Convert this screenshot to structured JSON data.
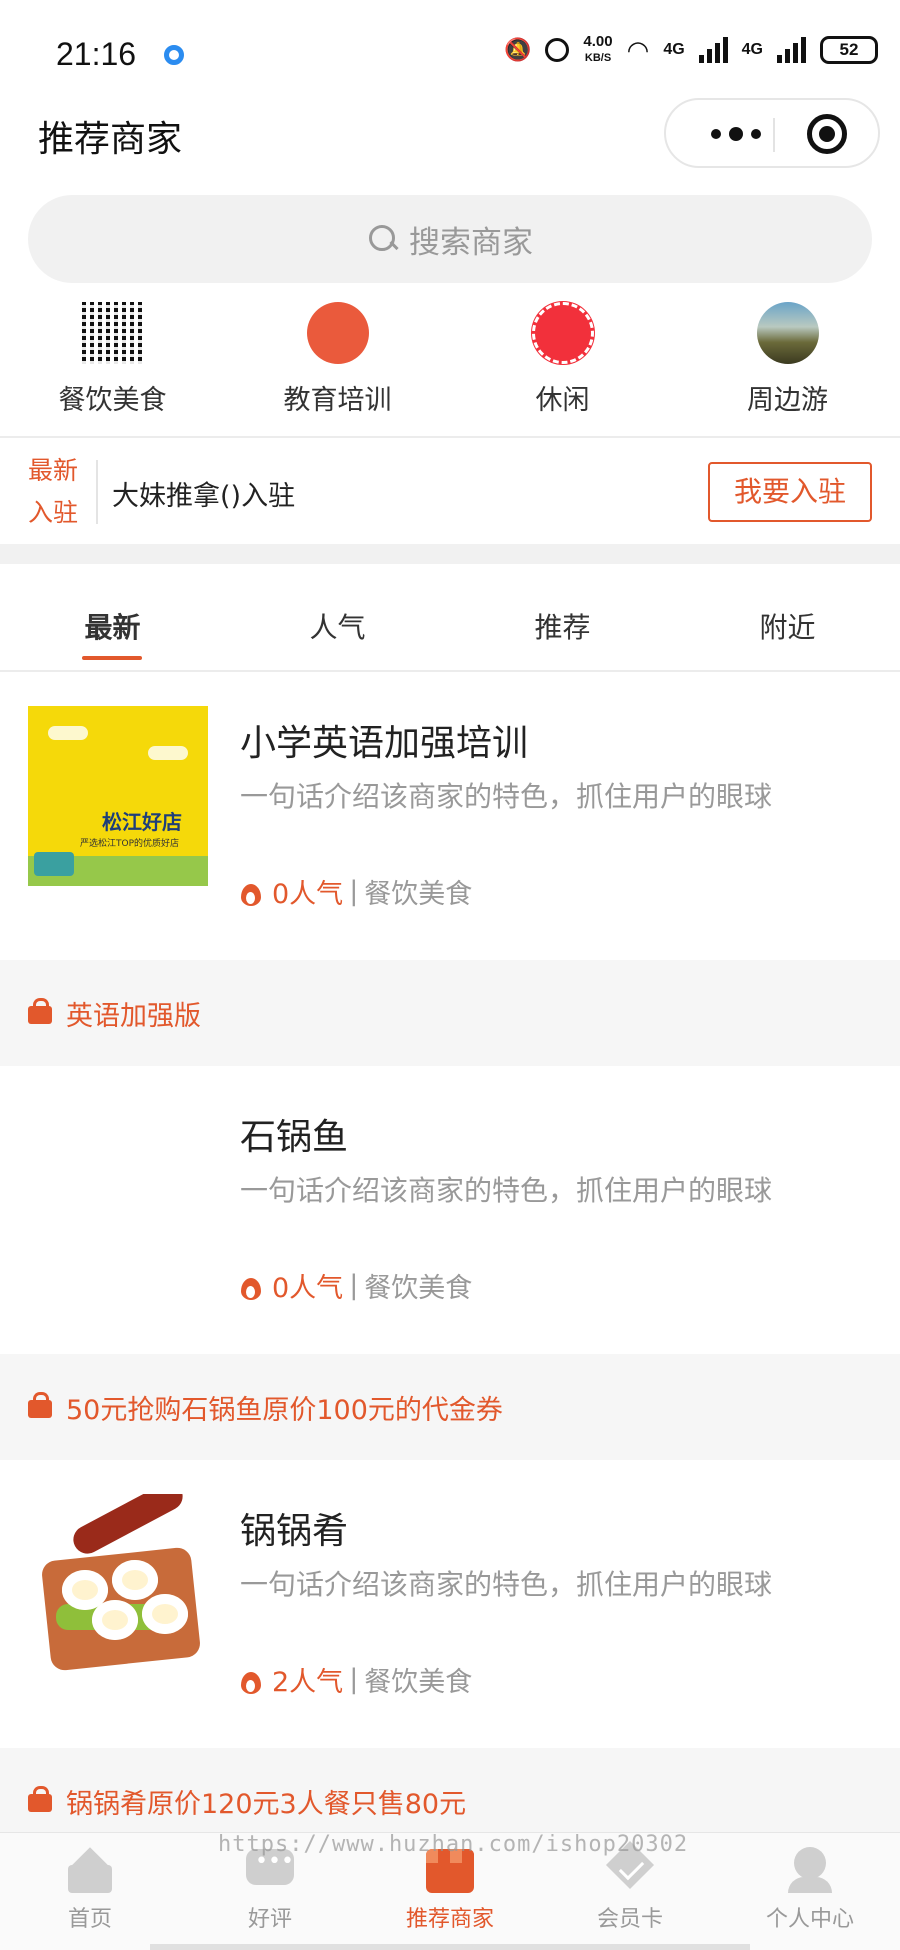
{
  "status_bar": {
    "time": "21:16",
    "speed_value": "4.00",
    "speed_unit": "KB/S",
    "network_1": "4G",
    "network_2": "4G",
    "battery": "52",
    "icons": [
      "mute-vibrate-icon",
      "alarm-icon",
      "wifi-icon",
      "signal-icon",
      "battery-icon"
    ]
  },
  "header": {
    "title": "推荐商家",
    "capsule_icons": [
      "more-dots-icon",
      "close-target-icon"
    ]
  },
  "search": {
    "placeholder": "搜索商家"
  },
  "categories": [
    {
      "label": "餐饮美食",
      "icon": "qr-code-icon"
    },
    {
      "label": "教育培训",
      "icon": "badge-icon"
    },
    {
      "label": "休闲",
      "icon": "red-circle-icon"
    },
    {
      "label": "周边游",
      "icon": "landscape-icon"
    }
  ],
  "join_bar": {
    "tag_line1": "最新",
    "tag_line2": "入驻",
    "text": "大妹推拿()入驻",
    "button": "我要入驻"
  },
  "tabs": [
    {
      "label": "最新",
      "active": true
    },
    {
      "label": "人气",
      "active": false
    },
    {
      "label": "推荐",
      "active": false
    },
    {
      "label": "附近",
      "active": false
    }
  ],
  "shops": [
    {
      "name": "小学英语加强培训",
      "desc": "一句话介绍该商家的特色，抓住用户的眼球",
      "popularity": "0人气",
      "separator": "|",
      "category": "餐饮美食",
      "image_sign": "松江好店",
      "image_sub": "严选松江TOP的优质好店",
      "coupon": "英语加强版"
    },
    {
      "name": "石锅鱼",
      "desc": "一句话介绍该商家的特色，抓住用户的眼球",
      "popularity": "0人气",
      "separator": "|",
      "category": "餐饮美食",
      "coupon": "50元抢购石锅鱼原价100元的代金券"
    },
    {
      "name": "锅锅肴",
      "desc": "一句话介绍该商家的特色，抓住用户的眼球",
      "popularity": "2人气",
      "separator": "|",
      "category": "餐饮美食",
      "coupon": "锅锅肴原价120元3人餐只售80元"
    }
  ],
  "watermark": "https://www.huzhan.com/ishop20302",
  "bottom_nav": [
    {
      "label": "首页",
      "icon": "home-icon",
      "active": false
    },
    {
      "label": "好评",
      "icon": "chat-bubble-icon",
      "active": false
    },
    {
      "label": "推荐商家",
      "icon": "storefront-icon",
      "active": true
    },
    {
      "label": "会员卡",
      "icon": "diamond-check-icon",
      "active": false
    },
    {
      "label": "个人中心",
      "icon": "user-icon",
      "active": false
    }
  ],
  "colors": {
    "accent": "#e2582c",
    "muted_text": "#999999",
    "band_bg": "#f6f6f6"
  }
}
